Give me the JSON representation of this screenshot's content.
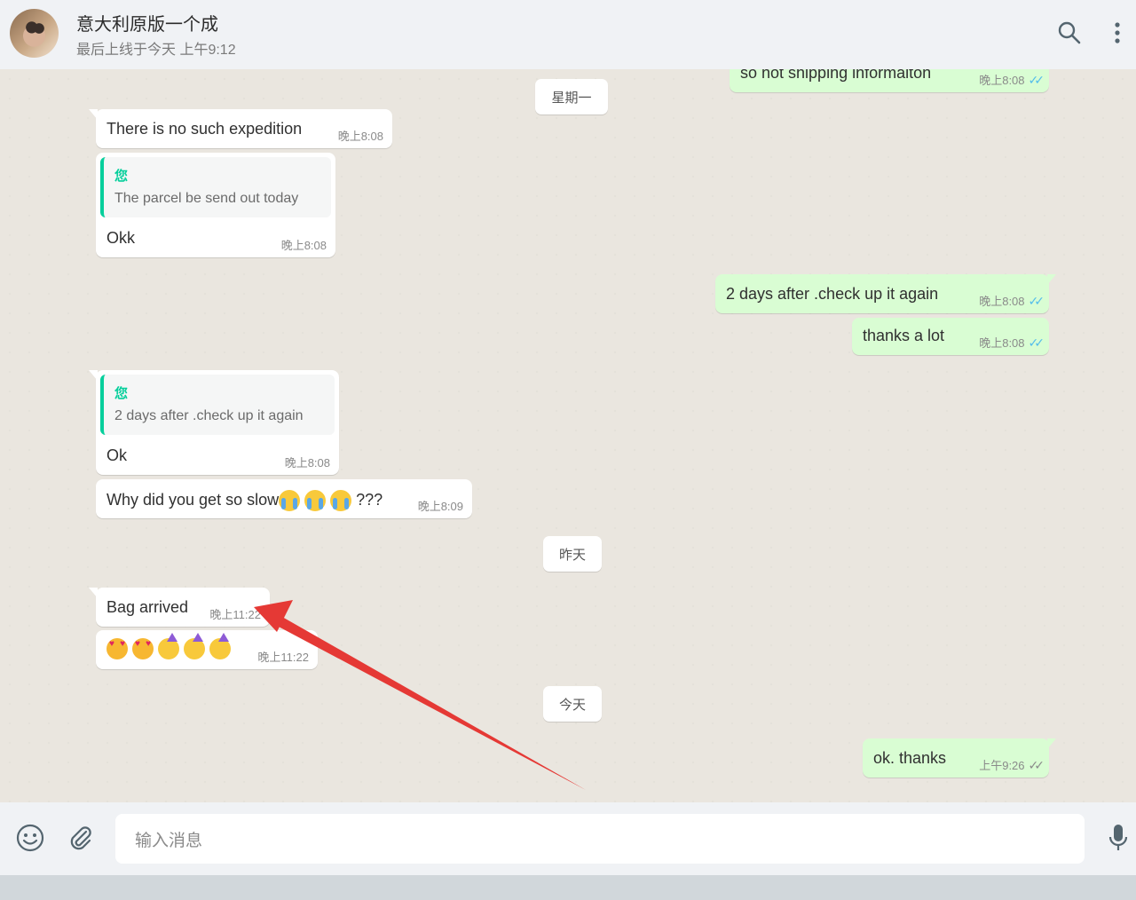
{
  "header": {
    "contact_name": "意大利原版一个成",
    "status": "最后上线于今天 上午9:12",
    "icons": [
      "search-icon",
      "menu-icon"
    ]
  },
  "dates": {
    "monday": "星期一",
    "yesterday": "昨天",
    "today": "今天"
  },
  "messages": {
    "m0": {
      "direction": "out",
      "text": "so not shipping informaiton",
      "time": "晚上8:08",
      "read": true
    },
    "m1": {
      "direction": "in",
      "text": "There is no such expedition",
      "time": "晚上8:08"
    },
    "m2": {
      "direction": "in",
      "quote_author": "您",
      "quote_text": "The parcel be send out today",
      "text": "Okk",
      "time": "晚上8:08"
    },
    "m3": {
      "direction": "out",
      "text": "2 days after .check up it again",
      "time": "晚上8:08",
      "read": true
    },
    "m4": {
      "direction": "out",
      "text": "thanks a lot",
      "time": "晚上8:08",
      "read": true
    },
    "m5": {
      "direction": "in",
      "quote_author": "您",
      "quote_text": "2 days after .check up it again",
      "text": "Ok",
      "time": "晚上8:08"
    },
    "m6": {
      "direction": "in",
      "text": "Why did you get so slow",
      "text_suffix": "???",
      "emojis": [
        "loudly-crying-face",
        "loudly-crying-face",
        "loudly-crying-face"
      ],
      "time": "晚上8:09"
    },
    "m7": {
      "direction": "in",
      "text": "Bag arrived",
      "time": "晚上11:22"
    },
    "m8": {
      "direction": "in",
      "emojis": [
        "heart-eyes-cat",
        "heart-eyes-cat",
        "partying-face",
        "partying-face",
        "partying-face"
      ],
      "time": "晚上11:22"
    },
    "m9": {
      "direction": "out",
      "text": "ok. thanks",
      "time": "上午9:26",
      "read": false
    }
  },
  "composer": {
    "placeholder": "输入消息",
    "icons": [
      "emoji-icon",
      "attach-icon",
      "microphone-icon"
    ]
  },
  "annotation": {
    "color": "#e53935"
  },
  "colors": {
    "incoming": "#ffffff",
    "outgoing": "#d9fdd3",
    "read_tick": "#53bdeb",
    "quote_accent": "#06cf9c"
  }
}
